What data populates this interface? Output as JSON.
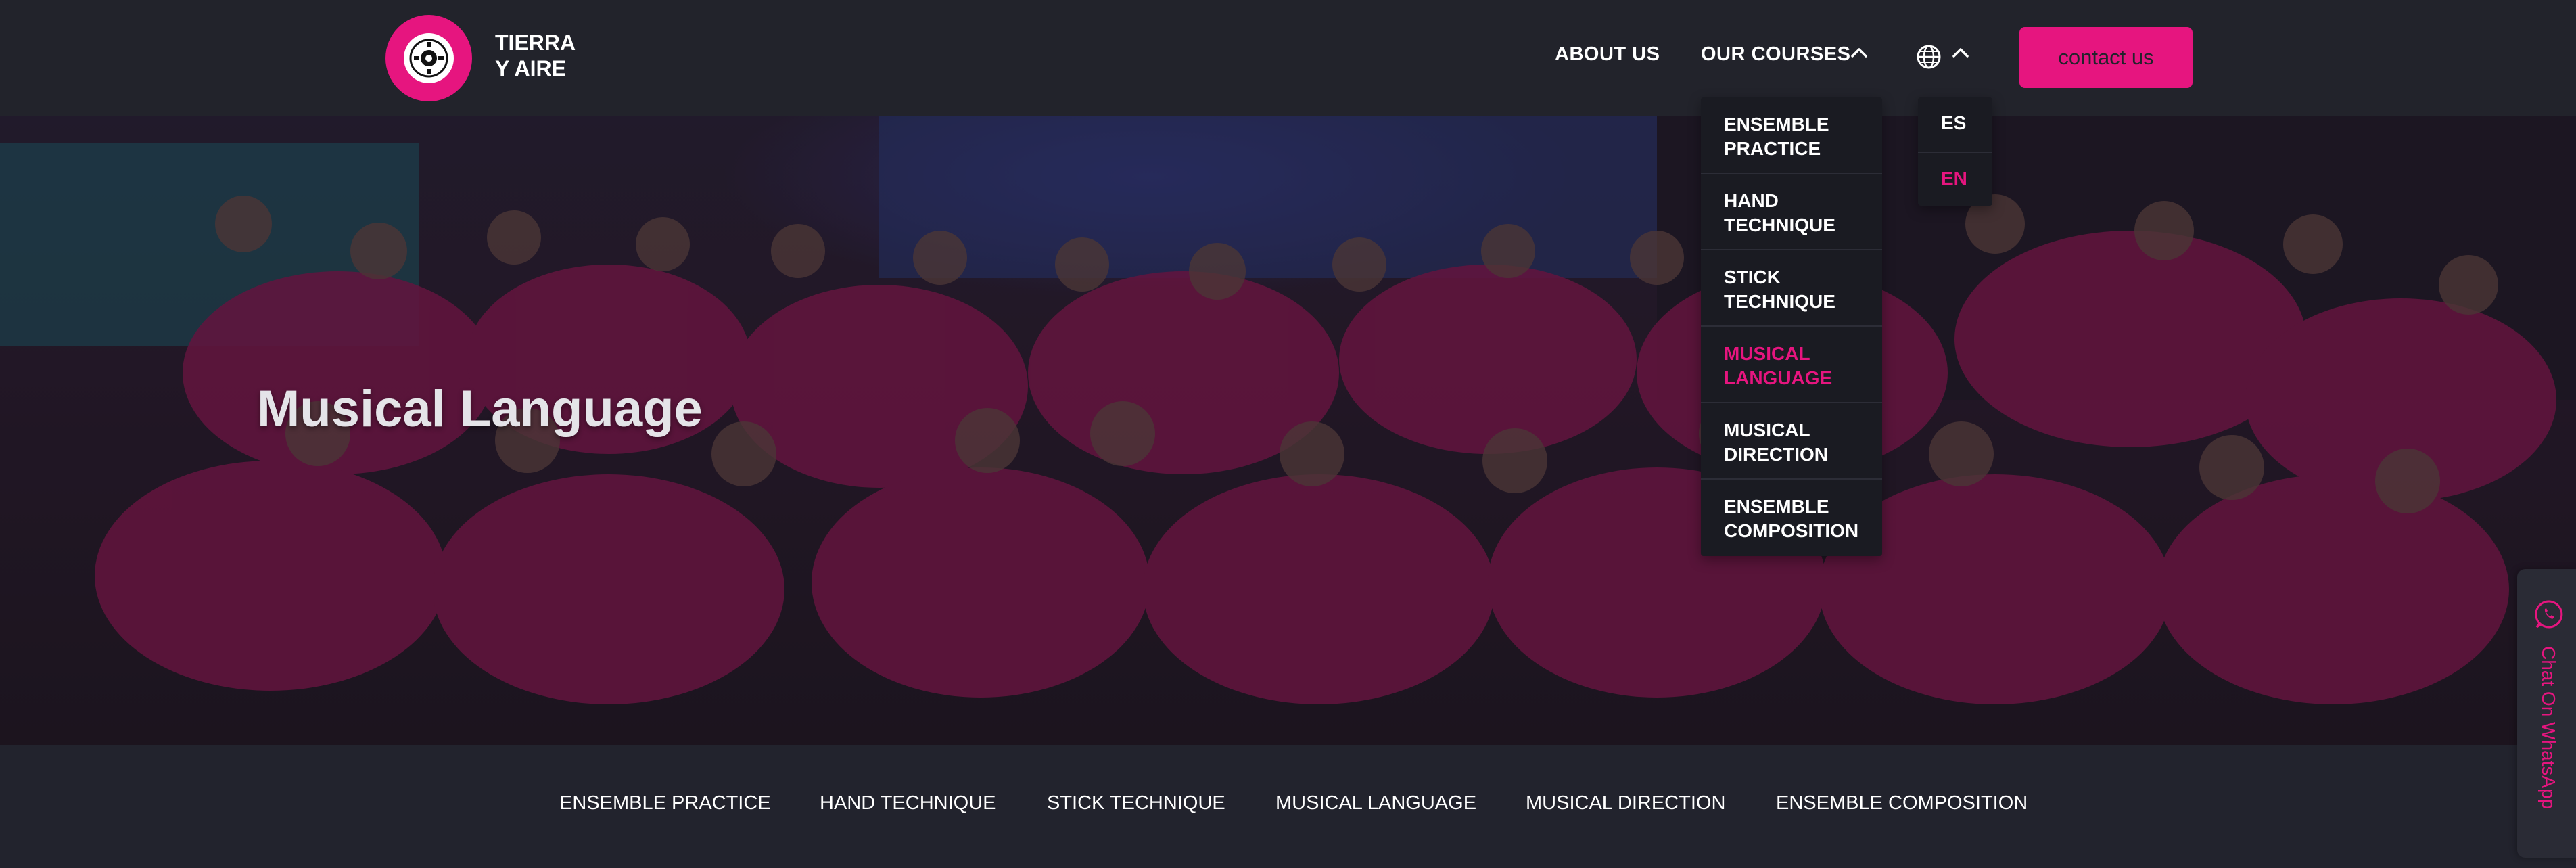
{
  "brand": {
    "line1": "TIERRA",
    "line2": "Y AIRE"
  },
  "nav": {
    "about": "ABOUT US",
    "courses": "OUR COURSES",
    "contact": "contact us"
  },
  "courses_menu": [
    {
      "line1": "ENSEMBLE",
      "line2": "PRACTICE",
      "active": false
    },
    {
      "line1": "HAND",
      "line2": "TECHNIQUE",
      "active": false
    },
    {
      "line1": "STICK",
      "line2": "TECHNIQUE",
      "active": false
    },
    {
      "line1": "MUSICAL",
      "line2": "LANGUAGE",
      "active": true
    },
    {
      "line1": "MUSICAL",
      "line2": "DIRECTION",
      "active": false
    },
    {
      "line1": "ENSEMBLE",
      "line2": "COMPOSITION",
      "active": false
    }
  ],
  "languages": [
    {
      "code": "ES",
      "active": false
    },
    {
      "code": "EN",
      "active": true
    }
  ],
  "hero": {
    "title": "Musical Language"
  },
  "bottom_nav": [
    "ENSEMBLE PRACTICE",
    "HAND TECHNIQUE",
    "STICK TECHNIQUE",
    "MUSICAL LANGUAGE",
    "MUSICAL DIRECTION",
    "ENSEMBLE COMPOSITION"
  ],
  "whatsapp": {
    "label": "Chat On WhatsApp"
  },
  "icons": {
    "logo": "drum-logo-icon",
    "courses_toggle": "chevron-up-icon",
    "language": "globe-icon",
    "language_toggle": "chevron-up-icon",
    "whatsapp": "whatsapp-icon"
  },
  "colors": {
    "accent": "#e6157f",
    "header_bg": "#22232b",
    "menu_bg": "#1a1b22",
    "text": "#ffffff"
  }
}
